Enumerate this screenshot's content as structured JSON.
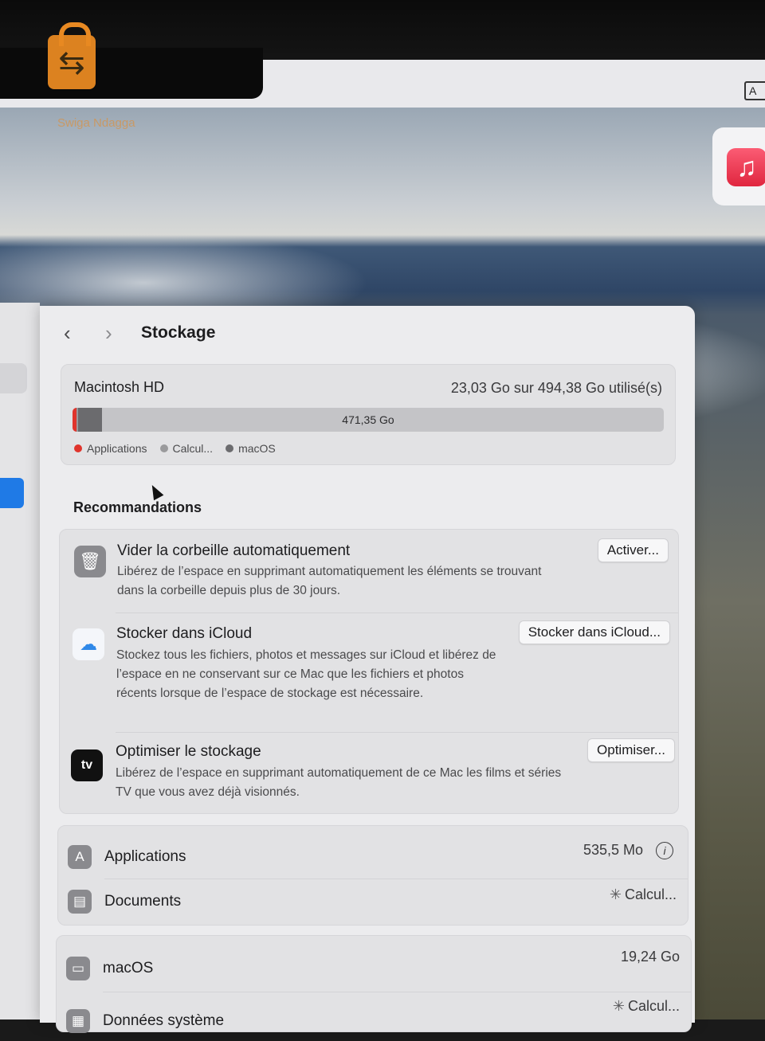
{
  "desktop": {
    "menubar_right_glyph": "A",
    "music_icon": "music-note-icon",
    "watermark_text": "Swiga Ndagga"
  },
  "header": {
    "title": "Stockage"
  },
  "disk": {
    "name": "Macintosh HD",
    "usage": "23,03 Go sur 494,38 Go utilisé(s)",
    "free_label": "471,35 Go",
    "used_fraction": 0.0466,
    "legend": [
      {
        "label": "Applications",
        "color": "#e0342c"
      },
      {
        "label": "Calcul...",
        "color": "#9a9a9c"
      },
      {
        "label": "macOS",
        "color": "#6b6b6e"
      }
    ]
  },
  "recommendations": {
    "title": "Recommandations",
    "items": [
      {
        "icon": "trash-icon",
        "title": "Vider la corbeille automatiquement",
        "description": "Libérez de l’espace en supprimant automatiquement les éléments se trouvant dans la corbeille depuis plus de 30 jours.",
        "button": "Activer..."
      },
      {
        "icon": "icloud-icon",
        "title": "Stocker dans iCloud",
        "description": "Stockez tous les fichiers, photos et messages sur iCloud et libérez de l’espace en ne conservant sur ce Mac que les fichiers et photos récents lorsque de l’espace de stockage est nécessaire.",
        "button": "Stocker dans iCloud..."
      },
      {
        "icon": "apple-tv-icon",
        "icon_text": "tv",
        "title": "Optimiser le stockage",
        "description": "Libérez de l’espace en supprimant automatiquement de ce Mac les films et séries TV que vous avez déjà visionnés.",
        "button": "Optimiser..."
      }
    ]
  },
  "categories": [
    {
      "icon": "app-store-icon",
      "label": "Applications",
      "size": "535,5 Mo"
    },
    {
      "icon": "document-icon",
      "label": "Documents",
      "size": "Calcul..."
    },
    {
      "icon": "laptop-icon",
      "label": "macOS",
      "size": "19,24 Go"
    },
    {
      "icon": "system-data-icon",
      "label": "Données système",
      "size": "Calcul..."
    }
  ]
}
